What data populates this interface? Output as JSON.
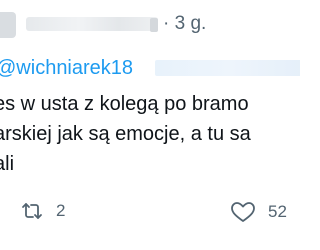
{
  "header": {
    "time_separator": "·",
    "time_ago": "3 g."
  },
  "reply": {
    "mention": "@wichniarek18"
  },
  "tweet": {
    "lines": [
      "es w usta z kolegą po bramo",
      "arskiej jak są emocje, a tu sa",
      "ali"
    ]
  },
  "actions": {
    "retweet_icon": "retweet-icon",
    "retweet_count": "2",
    "like_icon": "heart-icon",
    "like_count": "52"
  },
  "colors": {
    "link": "#1d9bf0",
    "muted": "#536471",
    "text": "#0f1419"
  }
}
